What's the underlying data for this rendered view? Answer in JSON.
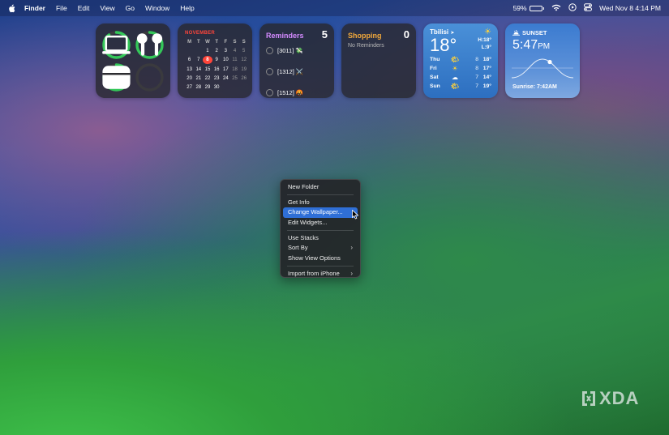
{
  "menubar": {
    "app_name": "Finder",
    "menus": [
      "File",
      "Edit",
      "View",
      "Go",
      "Window",
      "Help"
    ],
    "battery_percent": "59%",
    "battery_level": 0.59,
    "datetime": "Wed Nov 8  4:14 PM"
  },
  "battery_widget": {
    "devices": [
      {
        "icon": "laptop-icon",
        "level": 0.9
      },
      {
        "icon": "airpods-icon",
        "level": 0.85
      },
      {
        "icon": "airpods-case-icon",
        "level": 0.8
      },
      {
        "icon": "empty-slot",
        "level": 0
      }
    ]
  },
  "calendar": {
    "month": "NOVEMBER",
    "weekdays": [
      "M",
      "T",
      "W",
      "T",
      "F",
      "S",
      "S"
    ],
    "today": "8",
    "weeks": [
      [
        "",
        "",
        "1",
        "2",
        "3",
        "4",
        "5"
      ],
      [
        "6",
        "7",
        "8",
        "9",
        "10",
        "11",
        "12"
      ],
      [
        "13",
        "14",
        "15",
        "16",
        "17",
        "18",
        "19"
      ],
      [
        "20",
        "21",
        "22",
        "23",
        "24",
        "25",
        "26"
      ],
      [
        "27",
        "28",
        "29",
        "30",
        "",
        "",
        ""
      ]
    ]
  },
  "reminders": {
    "title": "Reminders",
    "count": "5",
    "items": [
      "[3011] 💸",
      "[1312] ⚔️",
      "[1512] 🤬"
    ]
  },
  "shopping": {
    "title": "Shopping",
    "count": "0",
    "empty_text": "No Reminders"
  },
  "weather": {
    "city": "Tbilisi",
    "temp": "18°",
    "high": "H:18°",
    "low": "L:9°",
    "forecast": [
      {
        "day": "Thu",
        "icon": "sun-cloud-icon",
        "lo": "8",
        "hi": "18°"
      },
      {
        "day": "Fri",
        "icon": "sun-icon",
        "lo": "8",
        "hi": "17°"
      },
      {
        "day": "Sat",
        "icon": "cloud-icon",
        "lo": "7",
        "hi": "14°"
      },
      {
        "day": "Sun",
        "icon": "sun-cloud-icon",
        "lo": "7",
        "hi": "19°"
      }
    ]
  },
  "sunset": {
    "label": "SUNSET",
    "time": "5:47",
    "ampm": "PM",
    "sunrise": "Sunrise: 7:42AM"
  },
  "context_menu": {
    "items": [
      {
        "label": "New Folder",
        "submenu": false,
        "highlighted": false
      },
      {
        "sep": true
      },
      {
        "label": "Get Info",
        "submenu": false,
        "highlighted": false
      },
      {
        "label": "Change Wallpaper...",
        "submenu": false,
        "highlighted": true
      },
      {
        "label": "Edit Widgets...",
        "submenu": false,
        "highlighted": false
      },
      {
        "sep": true
      },
      {
        "label": "Use Stacks",
        "submenu": false,
        "highlighted": false
      },
      {
        "label": "Sort By",
        "submenu": true,
        "highlighted": false
      },
      {
        "label": "Show View Options",
        "submenu": false,
        "highlighted": false
      },
      {
        "sep": true
      },
      {
        "label": "Import from iPhone",
        "submenu": true,
        "highlighted": false
      }
    ]
  },
  "watermark": "XDA",
  "colors": {
    "highlight": "#2f6fd6",
    "ring": "#34c759",
    "today": "#ff453a",
    "reminders": "#d48bff",
    "shopping": "#f2a93b"
  }
}
